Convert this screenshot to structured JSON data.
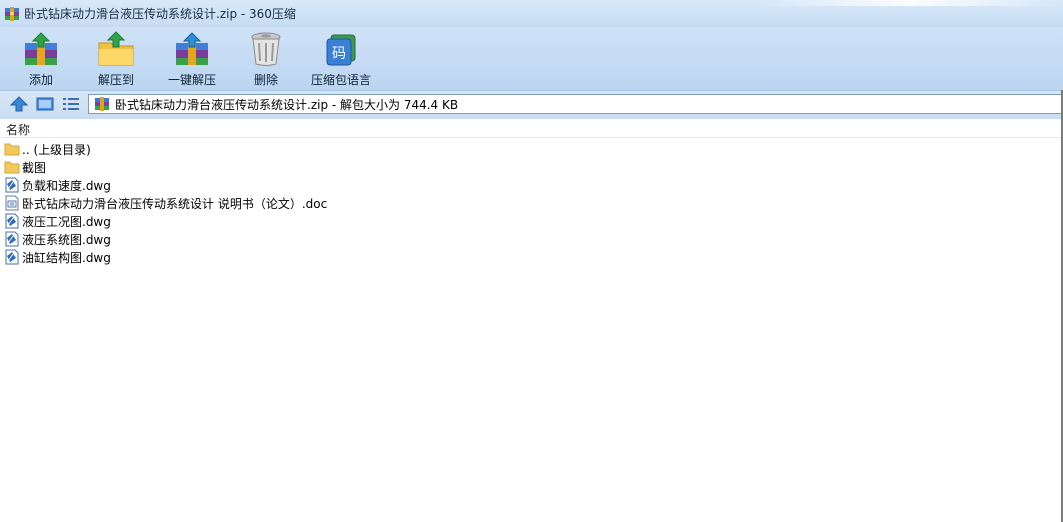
{
  "window": {
    "title": "卧式钻床动力滑台液压传动系统设计.zip - 360压缩"
  },
  "toolbar": {
    "add_label": "添加",
    "extract_to_label": "解压到",
    "one_click_extract_label": "一键解压",
    "delete_label": "删除",
    "language_label": "压缩包语言"
  },
  "address": {
    "path": "卧式钻床动力滑台液压传动系统设计.zip - 解包大小为 744.4 KB"
  },
  "list": {
    "column_name": "名称",
    "items": [
      {
        "name": ".. (上级目录)",
        "icon": "folder-icon"
      },
      {
        "name": "截图",
        "icon": "folder-icon"
      },
      {
        "name": "负载和速度.dwg",
        "icon": "dwg-file-icon"
      },
      {
        "name": "卧式钻床动力滑台液压传动系统设计 说明书（论文）.doc",
        "icon": "doc-file-icon"
      },
      {
        "name": "液压工况图.dwg",
        "icon": "dwg-file-icon"
      },
      {
        "name": "液压系统图.dwg",
        "icon": "dwg-file-icon"
      },
      {
        "name": "油缸结构图.dwg",
        "icon": "dwg-file-icon"
      }
    ]
  }
}
